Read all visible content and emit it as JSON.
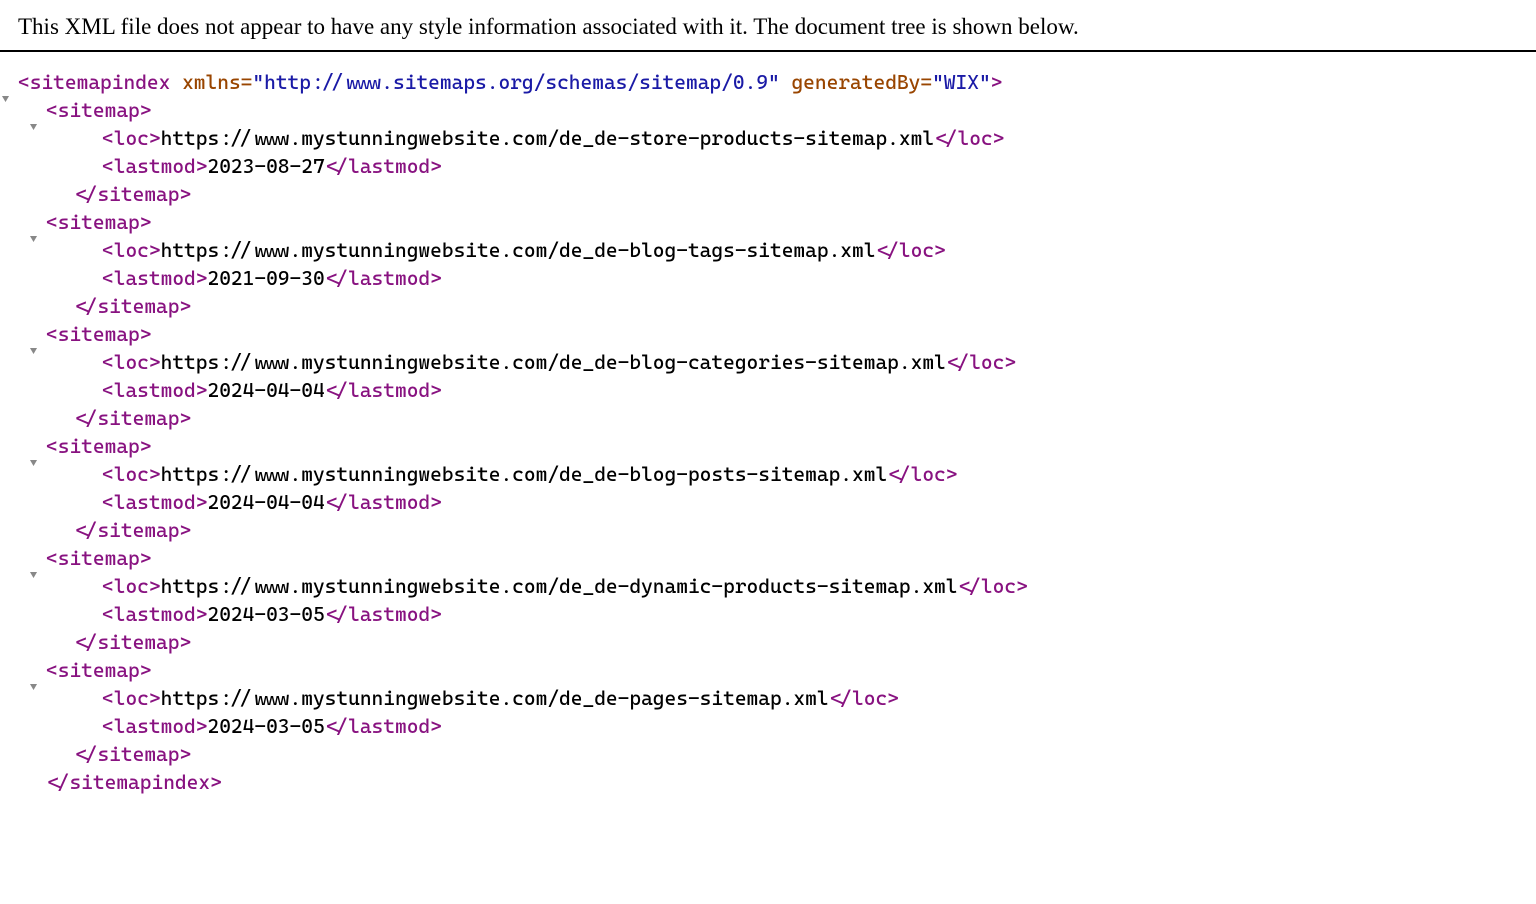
{
  "header_message": "This XML file does not appear to have any style information associated with it. The document tree is shown below.",
  "open_bracket": "<",
  "close_bracket": ">",
  "slash": "/",
  "equals": "=",
  "quote": "\"",
  "caret": "▼",
  "root": {
    "tag": "sitemapindex",
    "attrs": [
      {
        "name": "xmlns",
        "value": "http://www.sitemaps.org/schemas/sitemap/0.9"
      },
      {
        "name": "generatedBy",
        "value": "WIX"
      }
    ]
  },
  "child_tag": "sitemap",
  "loc_tag": "loc",
  "lastmod_tag": "lastmod",
  "sitemaps": [
    {
      "loc": "https://www.mystunningwebsite.com/de_de-store-products-sitemap.xml",
      "lastmod": "2023-08-27"
    },
    {
      "loc": "https://www.mystunningwebsite.com/de_de-blog-tags-sitemap.xml",
      "lastmod": "2021-09-30"
    },
    {
      "loc": "https://www.mystunningwebsite.com/de_de-blog-categories-sitemap.xml",
      "lastmod": "2024-04-04"
    },
    {
      "loc": "https://www.mystunningwebsite.com/de_de-blog-posts-sitemap.xml",
      "lastmod": "2024-04-04"
    },
    {
      "loc": "https://www.mystunningwebsite.com/de_de-dynamic-products-sitemap.xml",
      "lastmod": "2024-03-05"
    },
    {
      "loc": "https://www.mystunningwebsite.com/de_de-pages-sitemap.xml",
      "lastmod": "2024-03-05"
    }
  ]
}
